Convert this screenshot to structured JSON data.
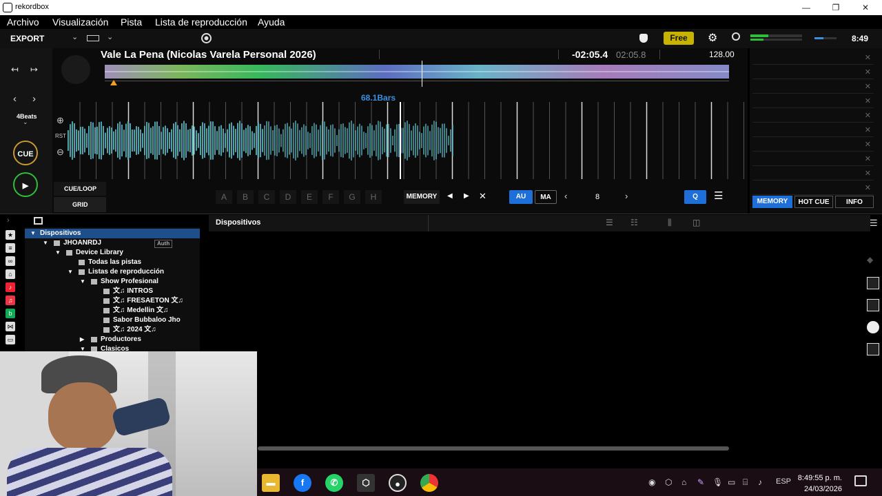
{
  "window": {
    "title": "rekordbox",
    "minimize": "—",
    "maximize": "❐",
    "close": "✕"
  },
  "menu": [
    "Archivo",
    "Visualización",
    "Pista",
    "Lista de reproducción",
    "Ayuda"
  ],
  "toolbar": {
    "mode": "EXPORT",
    "free_label": "Free",
    "clock": "8:49"
  },
  "deck": {
    "track_title": "Vale La Pena (Nicolas Varela Personal 2026)",
    "time_remaining": "-02:05.4",
    "time_total": "02:05.8",
    "bpm": "128.00",
    "bars": "68.1Bars",
    "beats": "4Beats",
    "rst": "RST",
    "cue_label": "CUE",
    "play_label": "▶",
    "cue_loop_label": "CUE/LOOP",
    "grid_label": "GRID",
    "pads": [
      "A",
      "B",
      "C",
      "D",
      "E",
      "F",
      "G",
      "H"
    ],
    "memory_label": "MEMORY",
    "au_label": "AU",
    "ma_label": "MA",
    "beat_count": "8",
    "q_label": "Q",
    "played_fraction": 0.46
  },
  "right_panel": {
    "tabs": [
      "MEMORY",
      "HOT CUE",
      "INFO"
    ],
    "active_tab": "MEMORY",
    "rows": 10
  },
  "browser": {
    "title": "Dispositivos",
    "tree": [
      {
        "label": "Dispositivos",
        "depth": 0,
        "arrow": "▼",
        "selected": true
      },
      {
        "label": "JHOANRDJ",
        "depth": 1,
        "arrow": "▼",
        "badge": "Auth"
      },
      {
        "label": "Device Library",
        "depth": 2,
        "arrow": "▼"
      },
      {
        "label": "Todas las pistas",
        "depth": 3,
        "arrow": ""
      },
      {
        "label": "Listas de reproducción",
        "depth": 3,
        "arrow": "▼"
      },
      {
        "label": "Show Profesional",
        "depth": 4,
        "arrow": "▼"
      },
      {
        "label": "文♫ INTROS",
        "depth": 5,
        "arrow": ""
      },
      {
        "label": "文♫ FRESAETON 文♫",
        "depth": 5,
        "arrow": ""
      },
      {
        "label": "文♫ Medellin 文♫",
        "depth": 5,
        "arrow": ""
      },
      {
        "label": "Sabor Bubbaloo  Jho",
        "depth": 5,
        "arrow": ""
      },
      {
        "label": "文♫ 2024 文♫",
        "depth": 5,
        "arrow": ""
      },
      {
        "label": "Productores",
        "depth": 4,
        "arrow": "▶"
      },
      {
        "label": "Clasicos",
        "depth": 4,
        "arrow": "▼"
      }
    ]
  },
  "taskbar": {
    "language": "ESP",
    "time": "8:49:55 p. m.",
    "date": "24/03/2026"
  },
  "colors": {
    "accent": "#1f6fd8",
    "free": "#c8b400",
    "cue_ring": "#c89a30",
    "play_ring": "#2fbf3a"
  }
}
